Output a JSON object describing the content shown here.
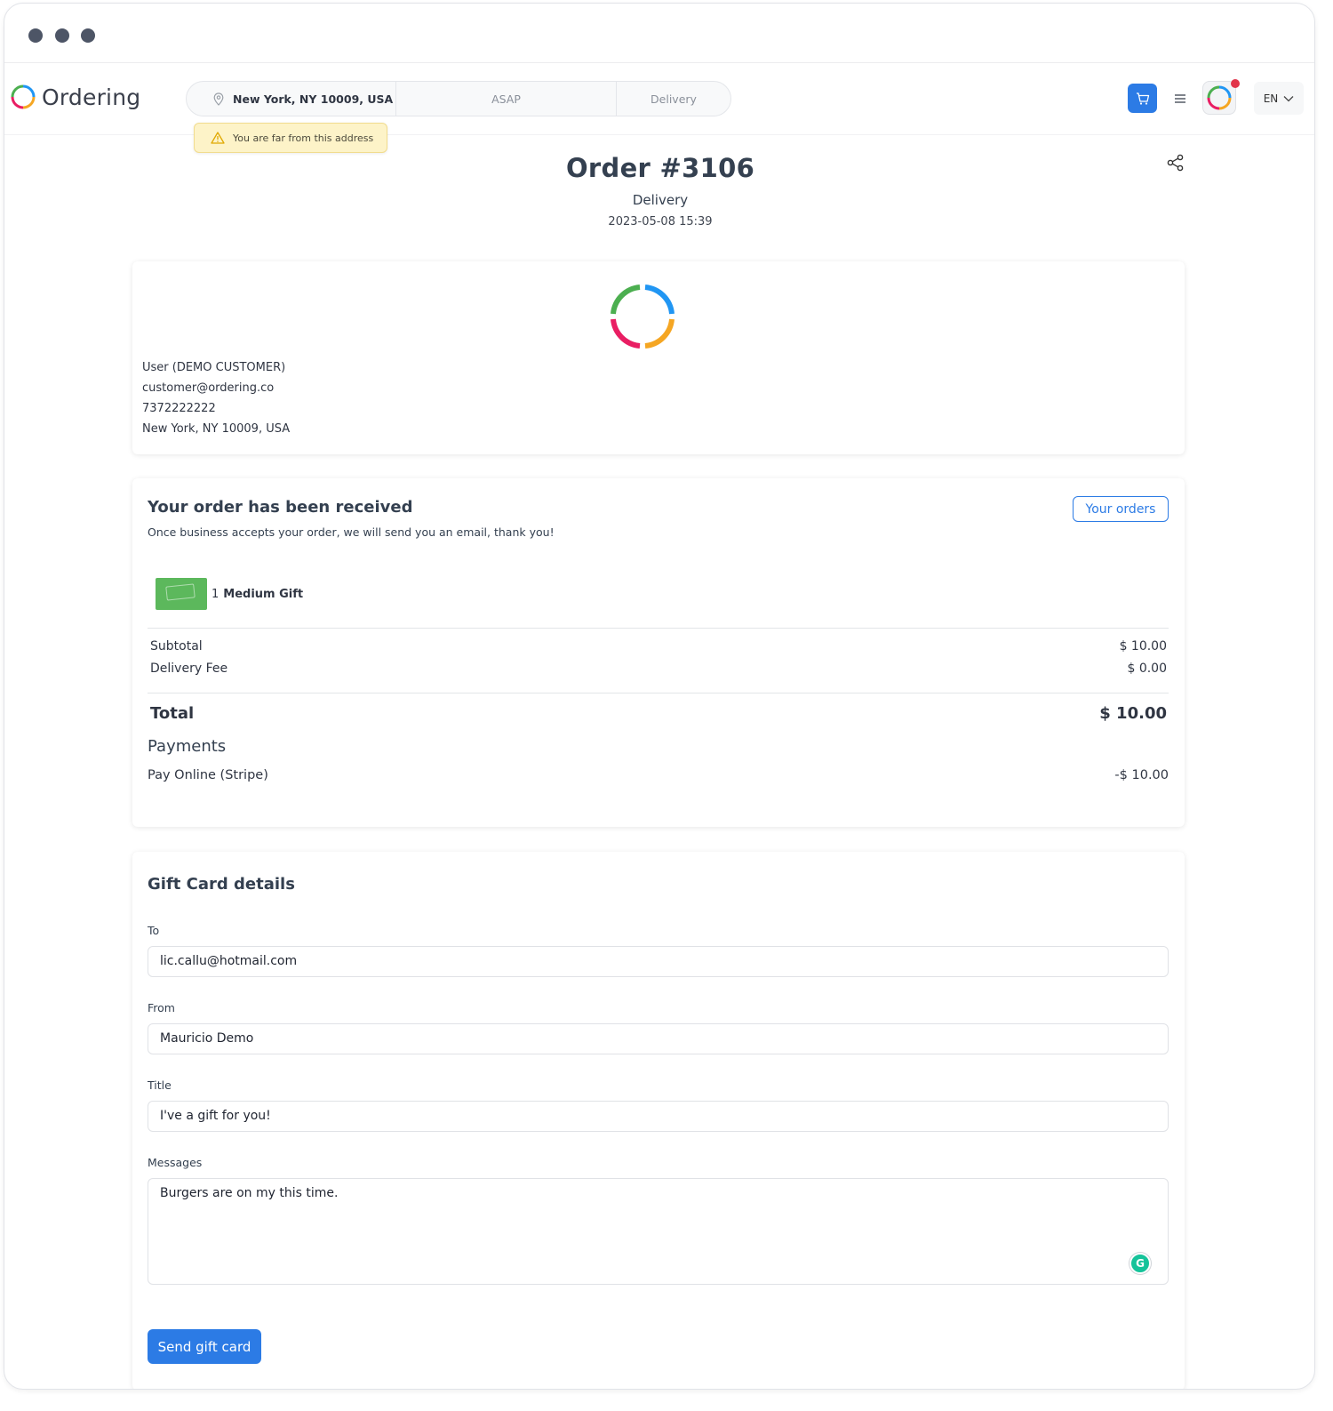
{
  "header": {
    "logo_text": "Ordering",
    "address": "New York, NY 10009, USA",
    "time": "ASAP",
    "order_type": "Delivery",
    "warning": "You are far from this address",
    "language": "EN"
  },
  "order": {
    "title": "Order #3106",
    "type": "Delivery",
    "date": "2023-05-08 15:39"
  },
  "customer": {
    "name": "User (DEMO CUSTOMER)",
    "email": "customer@ordering.co",
    "phone": "7372222222",
    "address": "New York, NY 10009, USA"
  },
  "status": {
    "title": "Your order has been received",
    "subtitle": "Once business accepts your order, we will send you an email, thank you!",
    "your_orders_label": "Your orders"
  },
  "products": [
    {
      "quantity": "1",
      "name": "Medium Gift"
    }
  ],
  "summary": {
    "subtotal_label": "Subtotal",
    "subtotal_value": "$ 10.00",
    "delivery_fee_label": "Delivery Fee",
    "delivery_fee_value": "$ 0.00",
    "total_label": "Total",
    "total_value": "$ 10.00"
  },
  "payments": {
    "title": "Payments",
    "method": "Pay Online (Stripe)",
    "amount": "-$ 10.00"
  },
  "gift_card": {
    "title": "Gift Card details",
    "to_label": "To",
    "to_value": "lic.callu@hotmail.com",
    "from_label": "From",
    "from_value": "Mauricio Demo",
    "title_label": "Title",
    "title_value": "I've a gift for you!",
    "messages_label": "Messages",
    "messages_value": "Burgers are on my this time.",
    "send_label": "Send gift card"
  },
  "colors": {
    "accent": "#2c7be5",
    "warning_bg": "#fdf3c8",
    "badge": "#e2344a"
  }
}
